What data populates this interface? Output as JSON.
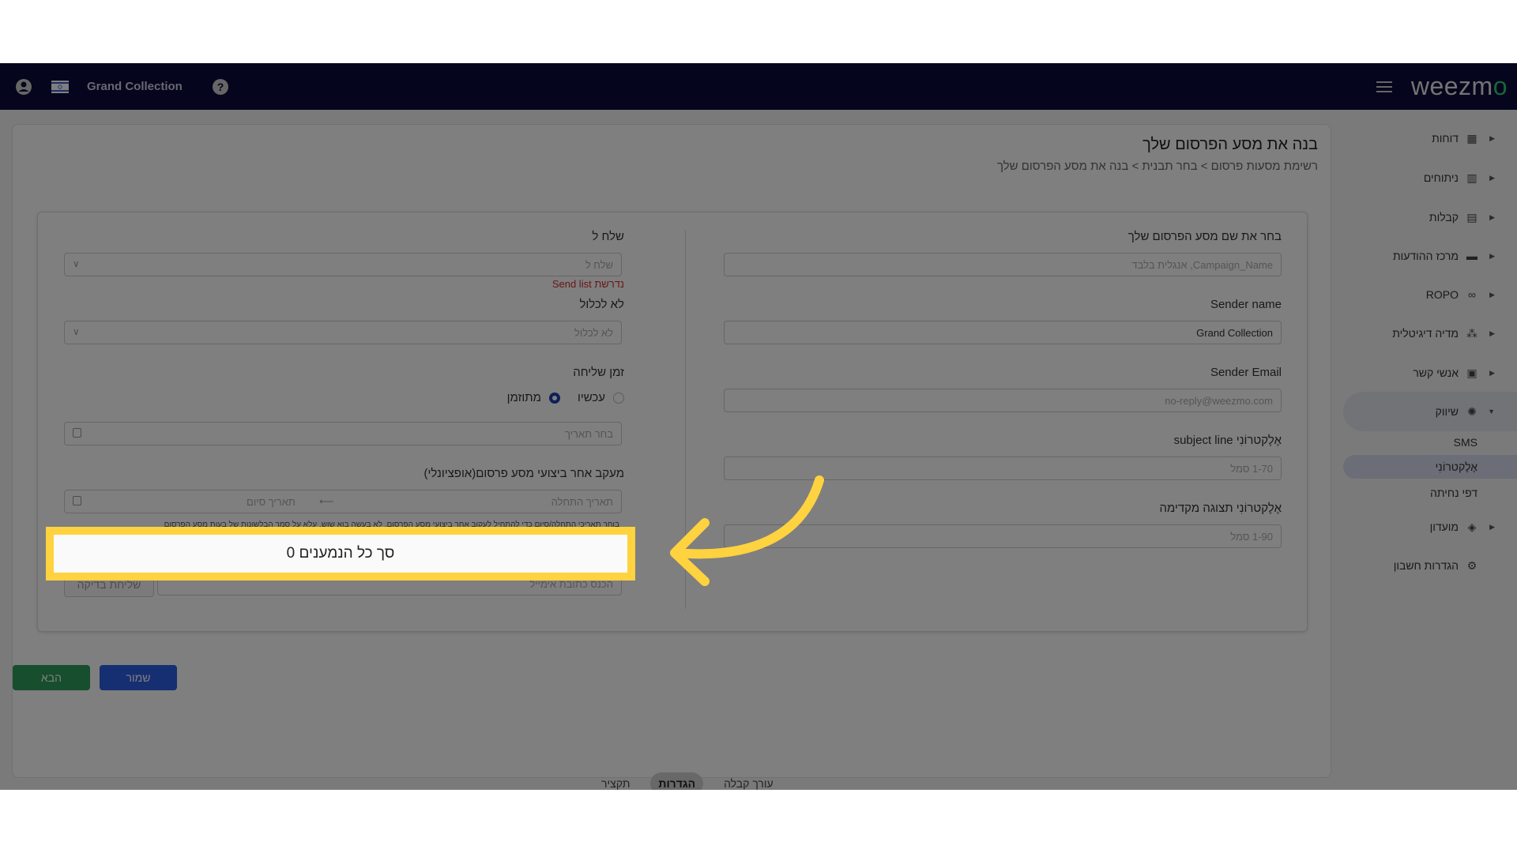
{
  "navbar": {
    "account_name": "Grand Collection",
    "logo_text": "weezm",
    "logo_accent": "o",
    "icons": [
      "user-icon",
      "israel-flag-icon",
      "help-icon",
      "hamburger-menu-icon"
    ]
  },
  "page": {
    "title": "בנה את מסע הפרסום שלך",
    "breadcrumb": "רשימת מסעות פרסום  >  בחר תבנית  >  בנה את מסע הפרסום שלך"
  },
  "form": {
    "right": {
      "campaign_name_label": "בחר את שם מסע הפרסום שלך",
      "campaign_name_placeholder": "Campaign_Name, אנגלית בלבד",
      "sender_name_label": "Sender name",
      "sender_name_value": "Grand Collection",
      "sender_email_label": "Sender Email",
      "sender_email_placeholder": "no-reply@weezmo.com",
      "subject_label": "אֶלֶקטרוֹנִי subject line",
      "subject_placeholder": "1-70 סמל",
      "preview_label": "אֶלֶקטרוֹנִי תצוגה מקדימה",
      "preview_placeholder": "1-90 סמל"
    },
    "left": {
      "send_to_label": "שלח ל",
      "send_to_placeholder": "שלח ל",
      "send_to_error": "נדרשת Send list",
      "exclude_label": "לא לכלול",
      "exclude_placeholder": "לא לכלול",
      "send_time_label": "זמן שליחה",
      "send_time_options": [
        {
          "label": "עכשיו",
          "selected": false
        },
        {
          "label": "מתוזמן",
          "selected": true
        }
      ],
      "date_placeholder": "בחר תאריך",
      "tracking_label": "מעקב אחר ביצועי מסע פרסום(אופציונלי)",
      "start_date_placeholder": "תאריך התחלה",
      "end_date_placeholder": "תאריך סיום",
      "helper_text": "בוחר תאריכי התחלה/סיום כדי להתחיל לעקוב אחר ביצועי מסע הפרסום. לא בעשה בוא שוש, עלא על סמך הבלשונות של בעות מסע הפרסום",
      "recipients_total": "סך כל הנמענים 0",
      "test_email_placeholder": "הכנס כתובת אימייל",
      "test_send_button": "שליחת בדיקה"
    }
  },
  "tabs": [
    {
      "label": "עורך קבלה",
      "active": false
    },
    {
      "label": "הגדרות",
      "active": true
    },
    {
      "label": "תקציר",
      "active": false
    }
  ],
  "buttons": {
    "save": "שמור",
    "next": "הבא"
  },
  "sidebar": {
    "items": [
      {
        "label": "דוחות",
        "icon": "dashboard-icon"
      },
      {
        "label": "ניתוחים",
        "icon": "analytics-icon"
      },
      {
        "label": "קבלות",
        "icon": "receipt-icon"
      },
      {
        "label": "מרכז ההודעות",
        "icon": "message-icon"
      },
      {
        "label": "ROPO",
        "icon": "infinity-icon"
      },
      {
        "label": "מדיה דיגיטלית",
        "icon": "group-icon"
      },
      {
        "label": "אנשי קשר",
        "icon": "contacts-icon"
      },
      {
        "label": "שיווק",
        "icon": "celebration-icon",
        "open": true
      },
      {
        "label": "מועדון",
        "icon": "tag-icon"
      },
      {
        "label": "הגדרות חשבון",
        "icon": "gear-icon"
      }
    ],
    "marketing_sub": [
      {
        "label": "SMS",
        "active": false
      },
      {
        "label": "אֶלֶקטרוֹנִי",
        "active": true
      },
      {
        "label": "דפי נחיתה",
        "active": false
      }
    ]
  },
  "colors": {
    "navbar": "#0a0a3a",
    "highlight": "#ffd23f",
    "save_button": "#2c5ee6",
    "next_button": "#2e9d5a",
    "error": "#d32f2f",
    "logo_accent": "#2ecc71"
  }
}
